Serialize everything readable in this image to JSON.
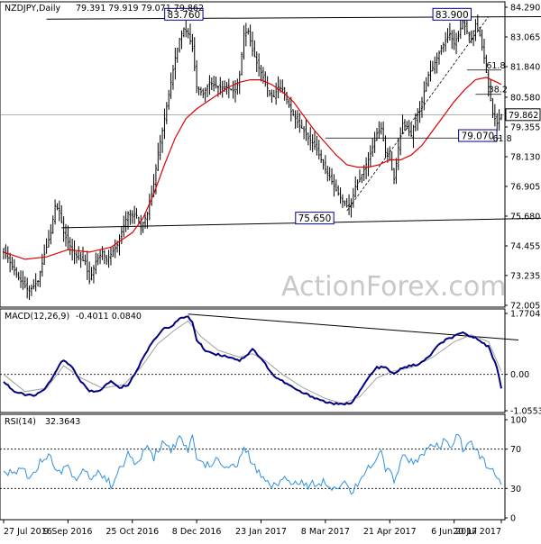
{
  "colors": {
    "candle": "#000000",
    "ma": "#e00000",
    "macd": "#000080",
    "signal": "#a0a0a0",
    "rsi": "#3090e0",
    "trendline": "#000000",
    "refline": "#808080",
    "boxed_label_border": "#00008b"
  },
  "chart_data": [
    {
      "type": "candlestick",
      "title": "NZDJPY,Daily",
      "ohlc_readout": "79.391 79.919 79.071 79.862",
      "last_price": "79.862",
      "ylim": [
        72.005,
        84.29
      ],
      "y_ticks": [
        "84.290",
        "83.065",
        "81.840",
        "80.580",
        "79.355",
        "78.130",
        "76.905",
        "75.680",
        "74.455",
        "73.235",
        "72.005"
      ],
      "x_ticks": [
        "27 Jul 2016",
        "9 Sep 2016",
        "25 Oct 2016",
        "8 Dec 2016",
        "23 Jan 2017",
        "8 Mar 2017",
        "21 Apr 2017",
        "6 Jun 2017",
        "20 Jul 2017"
      ],
      "annotations": [
        {
          "text": "83.760",
          "kind": "swing high"
        },
        {
          "text": "83.900",
          "kind": "swing high"
        },
        {
          "text": "75.650",
          "kind": "swing low"
        },
        {
          "text": "79.070",
          "kind": "current low"
        },
        {
          "text": "61.8",
          "kind": "fib"
        },
        {
          "text": "38.2",
          "kind": "fib"
        },
        {
          "text": "61.8",
          "kind": "fib"
        }
      ],
      "fib_levels": [
        81.7,
        80.7,
        78.9
      ],
      "horizontal_levels": [
        79.862
      ],
      "trendlines": [
        {
          "from": [
            20,
            83.8
          ],
          "to": [
            360,
            83.95
          ]
        },
        {
          "from": [
            27,
            75.2
          ],
          "to": [
            365,
            75.8
          ]
        }
      ],
      "close_path": [
        [
          0,
          74.3
        ],
        [
          4,
          73.6
        ],
        [
          8,
          73.0
        ],
        [
          12,
          72.6
        ],
        [
          16,
          73.0
        ],
        [
          19,
          74.1
        ],
        [
          22,
          75.0
        ],
        [
          24,
          76.1
        ],
        [
          26,
          75.9
        ],
        [
          28,
          75.0
        ],
        [
          30,
          74.6
        ],
        [
          34,
          74.0
        ],
        [
          38,
          73.8
        ],
        [
          40,
          73.0
        ],
        [
          43,
          73.8
        ],
        [
          46,
          74.2
        ],
        [
          48,
          73.9
        ],
        [
          50,
          74.1
        ],
        [
          53,
          74.5
        ],
        [
          56,
          75.3
        ],
        [
          58,
          75.8
        ],
        [
          62,
          75.7
        ],
        [
          64,
          75.2
        ],
        [
          67,
          75.8
        ],
        [
          70,
          77.0
        ],
        [
          72,
          78.3
        ],
        [
          74,
          79.2
        ],
        [
          76,
          80.2
        ],
        [
          78,
          81.2
        ],
        [
          80,
          82.2
        ],
        [
          82,
          83.0
        ],
        [
          84,
          83.4
        ],
        [
          86,
          83.2
        ],
        [
          88,
          82.6
        ],
        [
          90,
          81.0
        ],
        [
          93,
          80.7
        ],
        [
          96,
          81.2
        ],
        [
          100,
          81.0
        ],
        [
          104,
          81.0
        ],
        [
          108,
          80.8
        ],
        [
          110,
          81.5
        ],
        [
          112,
          83.2
        ],
        [
          114,
          83.3
        ],
        [
          116,
          82.5
        ],
        [
          118,
          82.0
        ],
        [
          120,
          81.6
        ],
        [
          122,
          81.2
        ],
        [
          124,
          80.7
        ],
        [
          126,
          80.6
        ],
        [
          128,
          81.0
        ],
        [
          130,
          80.9
        ],
        [
          132,
          80.5
        ],
        [
          134,
          80.0
        ],
        [
          136,
          79.7
        ],
        [
          138,
          79.4
        ],
        [
          140,
          79.2
        ],
        [
          142,
          78.9
        ],
        [
          144,
          78.7
        ],
        [
          146,
          78.4
        ],
        [
          148,
          78.0
        ],
        [
          150,
          77.6
        ],
        [
          152,
          77.3
        ],
        [
          154,
          76.9
        ],
        [
          156,
          76.6
        ],
        [
          158,
          76.3
        ],
        [
          160,
          76.1
        ],
        [
          162,
          76.2
        ],
        [
          164,
          76.9
        ],
        [
          166,
          77.2
        ],
        [
          168,
          77.6
        ],
        [
          170,
          78.0
        ],
        [
          172,
          78.5
        ],
        [
          174,
          79.1
        ],
        [
          176,
          79.3
        ],
        [
          178,
          78.3
        ],
        [
          180,
          78.0
        ],
        [
          182,
          77.2
        ],
        [
          184,
          78.5
        ],
        [
          186,
          79.5
        ],
        [
          188,
          79.3
        ],
        [
          190,
          79.0
        ],
        [
          192,
          79.7
        ],
        [
          194,
          80.0
        ],
        [
          196,
          80.8
        ],
        [
          198,
          81.5
        ],
        [
          200,
          81.8
        ],
        [
          202,
          82.2
        ],
        [
          204,
          82.6
        ],
        [
          206,
          82.9
        ],
        [
          208,
          83.2
        ],
        [
          210,
          82.8
        ],
        [
          212,
          83.1
        ],
        [
          214,
          83.7
        ],
        [
          216,
          83.3
        ],
        [
          218,
          83.0
        ],
        [
          220,
          83.6
        ],
        [
          222,
          83.1
        ],
        [
          224,
          82.2
        ],
        [
          226,
          81.0
        ],
        [
          228,
          79.9
        ],
        [
          230,
          79.5
        ],
        [
          232,
          79.86
        ]
      ],
      "ma_path": [
        [
          0,
          74.2
        ],
        [
          10,
          73.9
        ],
        [
          20,
          74.0
        ],
        [
          30,
          74.3
        ],
        [
          40,
          74.2
        ],
        [
          50,
          74.4
        ],
        [
          60,
          75.0
        ],
        [
          65,
          75.6
        ],
        [
          70,
          76.6
        ],
        [
          75,
          77.8
        ],
        [
          80,
          78.9
        ],
        [
          85,
          79.7
        ],
        [
          90,
          80.1
        ],
        [
          95,
          80.4
        ],
        [
          100,
          80.7
        ],
        [
          105,
          81.0
        ],
        [
          110,
          81.2
        ],
        [
          115,
          81.3
        ],
        [
          120,
          81.3
        ],
        [
          125,
          81.1
        ],
        [
          130,
          80.8
        ],
        [
          135,
          80.4
        ],
        [
          140,
          79.8
        ],
        [
          145,
          79.2
        ],
        [
          150,
          78.7
        ],
        [
          155,
          78.2
        ],
        [
          160,
          77.8
        ],
        [
          165,
          77.7
        ],
        [
          170,
          77.7
        ],
        [
          175,
          77.8
        ],
        [
          180,
          78.0
        ],
        [
          185,
          78.0
        ],
        [
          190,
          78.2
        ],
        [
          195,
          78.6
        ],
        [
          200,
          79.2
        ],
        [
          205,
          79.8
        ],
        [
          210,
          80.4
        ],
        [
          215,
          80.9
        ],
        [
          220,
          81.3
        ],
        [
          225,
          81.4
        ],
        [
          230,
          81.2
        ],
        [
          232,
          81.1
        ]
      ]
    },
    {
      "type": "line",
      "title": "MACD(12,26,9)",
      "values_readout": "-0.4011 0.0840",
      "ylim": [
        -1.0553,
        1.7704
      ],
      "y_ticks": [
        "1.7704",
        "0.00",
        "-1.0553"
      ],
      "macd_path": [
        [
          0,
          -0.2
        ],
        [
          5,
          -0.5
        ],
        [
          10,
          -0.6
        ],
        [
          15,
          -0.6
        ],
        [
          18,
          -0.5
        ],
        [
          22,
          -0.2
        ],
        [
          26,
          0.3
        ],
        [
          28,
          0.4
        ],
        [
          32,
          0.2
        ],
        [
          36,
          -0.2
        ],
        [
          40,
          -0.5
        ],
        [
          44,
          -0.5
        ],
        [
          48,
          -0.3
        ],
        [
          50,
          -0.2
        ],
        [
          54,
          -0.4
        ],
        [
          58,
          -0.3
        ],
        [
          62,
          0.1
        ],
        [
          66,
          0.6
        ],
        [
          70,
          1.0
        ],
        [
          74,
          1.3
        ],
        [
          78,
          1.4
        ],
        [
          82,
          1.6
        ],
        [
          86,
          1.7
        ],
        [
          88,
          1.5
        ],
        [
          90,
          1.0
        ],
        [
          94,
          0.7
        ],
        [
          98,
          0.6
        ],
        [
          102,
          0.55
        ],
        [
          106,
          0.5
        ],
        [
          110,
          0.4
        ],
        [
          114,
          0.6
        ],
        [
          116,
          0.75
        ],
        [
          118,
          0.6
        ],
        [
          122,
          0.3
        ],
        [
          126,
          -0.05
        ],
        [
          130,
          -0.2
        ],
        [
          134,
          -0.35
        ],
        [
          138,
          -0.5
        ],
        [
          142,
          -0.6
        ],
        [
          146,
          -0.7
        ],
        [
          150,
          -0.8
        ],
        [
          154,
          -0.85
        ],
        [
          158,
          -0.88
        ],
        [
          162,
          -0.82
        ],
        [
          166,
          -0.5
        ],
        [
          170,
          -0.1
        ],
        [
          174,
          0.2
        ],
        [
          178,
          0.2
        ],
        [
          182,
          0.0
        ],
        [
          186,
          0.2
        ],
        [
          190,
          0.25
        ],
        [
          194,
          0.3
        ],
        [
          198,
          0.5
        ],
        [
          202,
          0.8
        ],
        [
          206,
          1.0
        ],
        [
          210,
          1.1
        ],
        [
          214,
          1.2
        ],
        [
          218,
          1.1
        ],
        [
          222,
          1.0
        ],
        [
          226,
          0.8
        ],
        [
          230,
          0.2
        ],
        [
          232,
          -0.4
        ]
      ],
      "signal_path": [
        [
          0,
          0.0
        ],
        [
          10,
          -0.5
        ],
        [
          20,
          -0.4
        ],
        [
          28,
          0.25
        ],
        [
          36,
          -0.1
        ],
        [
          46,
          -0.4
        ],
        [
          56,
          -0.3
        ],
        [
          64,
          0.2
        ],
        [
          72,
          0.9
        ],
        [
          80,
          1.3
        ],
        [
          86,
          1.55
        ],
        [
          92,
          1.1
        ],
        [
          100,
          0.7
        ],
        [
          110,
          0.5
        ],
        [
          116,
          0.6
        ],
        [
          122,
          0.4
        ],
        [
          130,
          0.0
        ],
        [
          140,
          -0.4
        ],
        [
          150,
          -0.7
        ],
        [
          158,
          -0.85
        ],
        [
          166,
          -0.65
        ],
        [
          174,
          -0.1
        ],
        [
          182,
          0.1
        ],
        [
          190,
          0.2
        ],
        [
          200,
          0.5
        ],
        [
          210,
          0.95
        ],
        [
          218,
          1.15
        ],
        [
          226,
          0.95
        ],
        [
          232,
          0.08
        ]
      ],
      "trendlines": [
        {
          "from": [
            86,
            1.75
          ],
          "to": [
            240,
            1.0
          ]
        }
      ]
    },
    {
      "type": "line",
      "title": "RSI(14)",
      "values_readout": "32.3643",
      "ylim": [
        0,
        100
      ],
      "y_ticks": [
        "100",
        "70",
        "30",
        "0"
      ],
      "rsi_path": [
        [
          0,
          48
        ],
        [
          4,
          44
        ],
        [
          8,
          52
        ],
        [
          12,
          42
        ],
        [
          16,
          54
        ],
        [
          20,
          64
        ],
        [
          22,
          60
        ],
        [
          26,
          48
        ],
        [
          30,
          52
        ],
        [
          34,
          38
        ],
        [
          38,
          52
        ],
        [
          40,
          40
        ],
        [
          44,
          48
        ],
        [
          48,
          38
        ],
        [
          50,
          34
        ],
        [
          54,
          48
        ],
        [
          58,
          64
        ],
        [
          62,
          54
        ],
        [
          66,
          72
        ],
        [
          70,
          62
        ],
        [
          74,
          76
        ],
        [
          78,
          70
        ],
        [
          82,
          80
        ],
        [
          86,
          68
        ],
        [
          88,
          82
        ],
        [
          90,
          64
        ],
        [
          94,
          52
        ],
        [
          98,
          58
        ],
        [
          102,
          56
        ],
        [
          106,
          50
        ],
        [
          110,
          58
        ],
        [
          112,
          70
        ],
        [
          114,
          64
        ],
        [
          116,
          54
        ],
        [
          118,
          48
        ],
        [
          122,
          40
        ],
        [
          126,
          32
        ],
        [
          130,
          42
        ],
        [
          134,
          34
        ],
        [
          138,
          38
        ],
        [
          142,
          32
        ],
        [
          146,
          36
        ],
        [
          150,
          38
        ],
        [
          154,
          30
        ],
        [
          158,
          38
        ],
        [
          162,
          26
        ],
        [
          166,
          40
        ],
        [
          170,
          50
        ],
        [
          174,
          58
        ],
        [
          176,
          68
        ],
        [
          178,
          50
        ],
        [
          182,
          40
        ],
        [
          186,
          62
        ],
        [
          190,
          58
        ],
        [
          194,
          62
        ],
        [
          198,
          70
        ],
        [
          202,
          72
        ],
        [
          206,
          78
        ],
        [
          208,
          70
        ],
        [
          212,
          84
        ],
        [
          214,
          70
        ],
        [
          218,
          78
        ],
        [
          222,
          62
        ],
        [
          226,
          52
        ],
        [
          230,
          40
        ],
        [
          232,
          32
        ]
      ],
      "ref_lines": [
        70,
        30
      ]
    }
  ],
  "watermark": "ActionForex.com"
}
